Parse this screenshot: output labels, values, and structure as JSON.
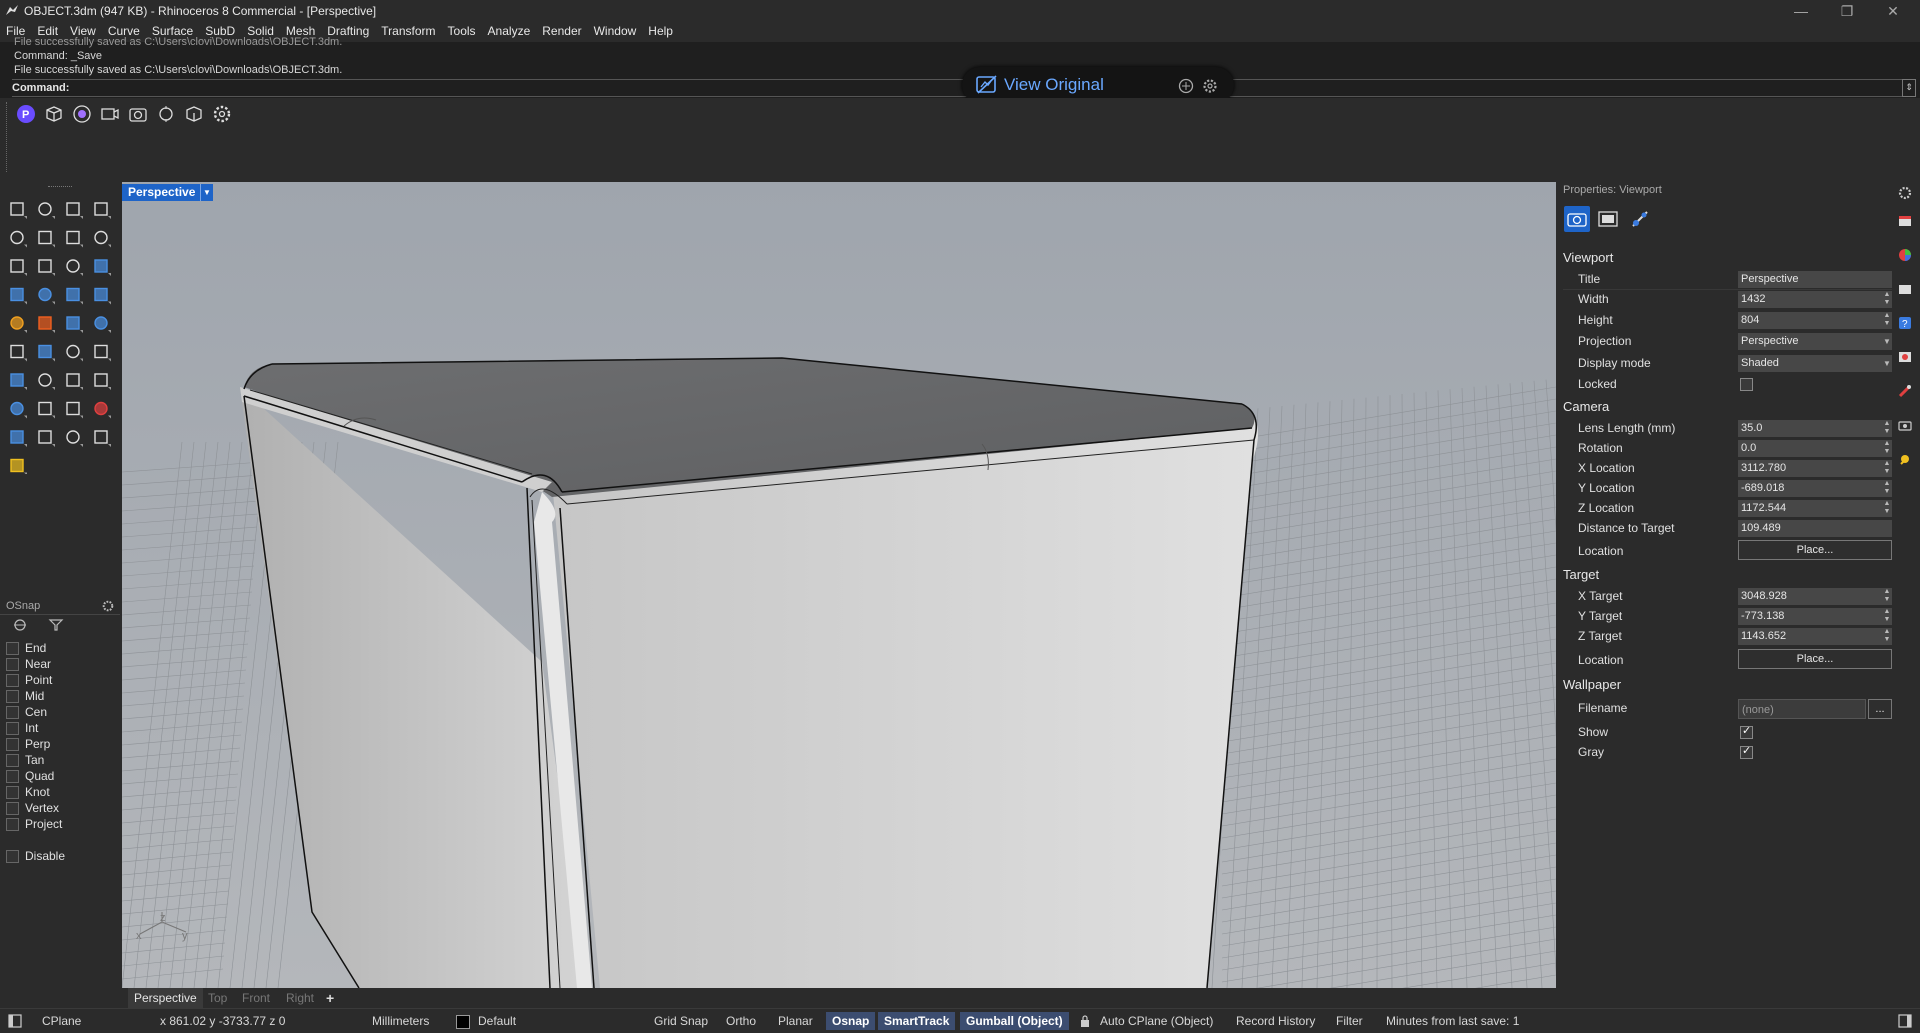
{
  "window": {
    "title": "OBJECT.3dm (947 KB) - Rhinoceros 8 Commercial - [Perspective]",
    "minimize": "—",
    "restore": "❐",
    "close": "✕"
  },
  "menu": [
    "File",
    "Edit",
    "View",
    "Curve",
    "Surface",
    "SubD",
    "Solid",
    "Mesh",
    "Drafting",
    "Transform",
    "Tools",
    "Analyze",
    "Render",
    "Window",
    "Help"
  ],
  "command": {
    "history": [
      "File successfully saved as C:\\Users\\clovi\\Downloads\\OBJECT.3dm.",
      "Command: _Save",
      "File successfully saved as C:\\Users\\clovi\\Downloads\\OBJECT.3dm."
    ],
    "prompt": "Command:"
  },
  "overlay": {
    "label": "View Original"
  },
  "viewport": {
    "active_name": "Perspective",
    "axis_z": "z",
    "axis_x": "x",
    "axis_y": "y"
  },
  "view_tabs": [
    "Perspective",
    "Top",
    "Front",
    "Right"
  ],
  "view_tabs_add": "+",
  "osnap": {
    "title": "OSnap",
    "items": [
      "End",
      "Near",
      "Point",
      "Mid",
      "Cen",
      "Int",
      "Perp",
      "Tan",
      "Quad",
      "Knot",
      "Vertex",
      "Project"
    ],
    "disable": "Disable"
  },
  "properties": {
    "title": "Properties: Viewport",
    "viewport_section": "Viewport",
    "title_label": "Title",
    "title_value": "Perspective",
    "width_label": "Width",
    "width_value": "1432",
    "height_label": "Height",
    "height_value": "804",
    "projection_label": "Projection",
    "projection_value": "Perspective",
    "display_label": "Display mode",
    "display_value": "Shaded",
    "locked_label": "Locked",
    "camera_section": "Camera",
    "lens_label": "Lens Length (mm)",
    "lens_value": "35.0",
    "rotation_label": "Rotation",
    "rotation_value": "0.0",
    "xloc_label": "X Location",
    "xloc_value": "3112.780",
    "yloc_label": "Y Location",
    "yloc_value": "-689.018",
    "zloc_label": "Z Location",
    "zloc_value": "1172.544",
    "dist_label": "Distance to Target",
    "dist_value": "109.489",
    "cam_location_label": "Location",
    "place_label": "Place...",
    "target_section": "Target",
    "xt_label": "X Target",
    "xt_value": "3048.928",
    "yt_label": "Y Target",
    "yt_value": "-773.138",
    "zt_label": "Z Target",
    "zt_value": "1143.652",
    "tgt_location_label": "Location",
    "wallpaper_section": "Wallpaper",
    "filename_label": "Filename",
    "filename_value": "(none)",
    "browse_label": "...",
    "show_label": "Show",
    "gray_label": "Gray"
  },
  "status": {
    "cplane": "CPlane",
    "coords": "x 861.02  y -3733.77  z 0",
    "units": "Millimeters",
    "layer": "Default",
    "grid_snap": "Grid Snap",
    "ortho": "Ortho",
    "planar": "Planar",
    "osnap": "Osnap",
    "smarttrack": "SmartTrack",
    "gumball": "Gumball (Object)",
    "auto_cplane": "Auto CPlane (Object)",
    "record_history": "Record History",
    "filter": "Filter",
    "last_save": "Minutes from last save: 1"
  },
  "colors": {
    "accent": "#1e64c8",
    "status_active": "#3c4d70",
    "viewport_bg": "#a9adb3"
  }
}
